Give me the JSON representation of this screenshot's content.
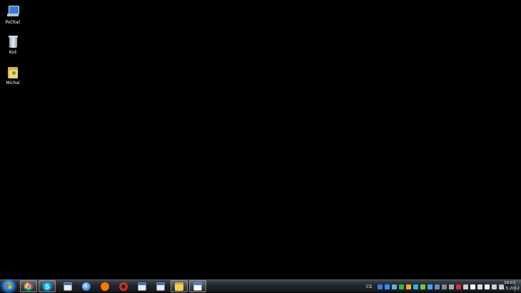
{
  "desktop": {
    "icons": [
      {
        "label": "Počítač",
        "icon": "computer-icon"
      },
      {
        "label": "Koš",
        "icon": "recycle-bin-icon"
      },
      {
        "label": "Michal",
        "icon": "user-folder-icon"
      }
    ]
  },
  "taskbar": {
    "pinned": [
      {
        "name": "chrome",
        "icon": "chrome-icon"
      },
      {
        "name": "skype",
        "icon": "skype-icon",
        "glyph": "S"
      },
      {
        "name": "calculator",
        "icon": "calculator-icon"
      },
      {
        "name": "network",
        "icon": "globe-icon"
      },
      {
        "name": "avast",
        "icon": "avast-icon"
      },
      {
        "name": "opera",
        "icon": "opera-icon"
      },
      {
        "name": "calculator-2",
        "icon": "calculator-icon"
      },
      {
        "name": "calculator-3",
        "icon": "calculator-icon"
      },
      {
        "name": "explorer",
        "icon": "folder-icon"
      },
      {
        "name": "document",
        "icon": "document-icon"
      }
    ],
    "language": "CS",
    "tray_icons": [
      "#2e7fe0",
      "#3a8ee6",
      "#6aa8e0",
      "#38b34a",
      "#f5a623",
      "#2bb6d8",
      "#7fc241",
      "#4aa3df",
      "#5c8fd6",
      "#888888",
      "#aaaaaa",
      "#cc3333",
      "#cccccc",
      "#ffffff",
      "#dddddd",
      "#eeeeee",
      "#cfcfcf",
      "#bbbbbb"
    ],
    "time": "19:01",
    "date": "21.5.2012"
  }
}
